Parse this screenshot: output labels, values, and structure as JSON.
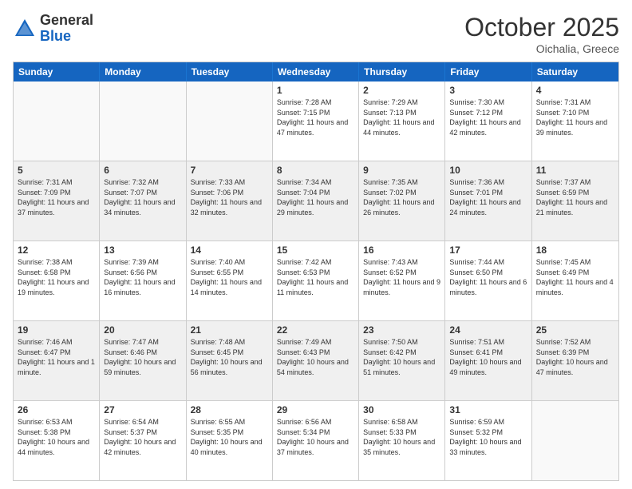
{
  "logo": {
    "general": "General",
    "blue": "Blue"
  },
  "title": "October 2025",
  "subtitle": "Oichalia, Greece",
  "days": [
    "Sunday",
    "Monday",
    "Tuesday",
    "Wednesday",
    "Thursday",
    "Friday",
    "Saturday"
  ],
  "rows": [
    [
      {
        "day": "",
        "text": ""
      },
      {
        "day": "",
        "text": ""
      },
      {
        "day": "",
        "text": ""
      },
      {
        "day": "1",
        "text": "Sunrise: 7:28 AM\nSunset: 7:15 PM\nDaylight: 11 hours and 47 minutes."
      },
      {
        "day": "2",
        "text": "Sunrise: 7:29 AM\nSunset: 7:13 PM\nDaylight: 11 hours and 44 minutes."
      },
      {
        "day": "3",
        "text": "Sunrise: 7:30 AM\nSunset: 7:12 PM\nDaylight: 11 hours and 42 minutes."
      },
      {
        "day": "4",
        "text": "Sunrise: 7:31 AM\nSunset: 7:10 PM\nDaylight: 11 hours and 39 minutes."
      }
    ],
    [
      {
        "day": "5",
        "text": "Sunrise: 7:31 AM\nSunset: 7:09 PM\nDaylight: 11 hours and 37 minutes."
      },
      {
        "day": "6",
        "text": "Sunrise: 7:32 AM\nSunset: 7:07 PM\nDaylight: 11 hours and 34 minutes."
      },
      {
        "day": "7",
        "text": "Sunrise: 7:33 AM\nSunset: 7:06 PM\nDaylight: 11 hours and 32 minutes."
      },
      {
        "day": "8",
        "text": "Sunrise: 7:34 AM\nSunset: 7:04 PM\nDaylight: 11 hours and 29 minutes."
      },
      {
        "day": "9",
        "text": "Sunrise: 7:35 AM\nSunset: 7:02 PM\nDaylight: 11 hours and 26 minutes."
      },
      {
        "day": "10",
        "text": "Sunrise: 7:36 AM\nSunset: 7:01 PM\nDaylight: 11 hours and 24 minutes."
      },
      {
        "day": "11",
        "text": "Sunrise: 7:37 AM\nSunset: 6:59 PM\nDaylight: 11 hours and 21 minutes."
      }
    ],
    [
      {
        "day": "12",
        "text": "Sunrise: 7:38 AM\nSunset: 6:58 PM\nDaylight: 11 hours and 19 minutes."
      },
      {
        "day": "13",
        "text": "Sunrise: 7:39 AM\nSunset: 6:56 PM\nDaylight: 11 hours and 16 minutes."
      },
      {
        "day": "14",
        "text": "Sunrise: 7:40 AM\nSunset: 6:55 PM\nDaylight: 11 hours and 14 minutes."
      },
      {
        "day": "15",
        "text": "Sunrise: 7:42 AM\nSunset: 6:53 PM\nDaylight: 11 hours and 11 minutes."
      },
      {
        "day": "16",
        "text": "Sunrise: 7:43 AM\nSunset: 6:52 PM\nDaylight: 11 hours and 9 minutes."
      },
      {
        "day": "17",
        "text": "Sunrise: 7:44 AM\nSunset: 6:50 PM\nDaylight: 11 hours and 6 minutes."
      },
      {
        "day": "18",
        "text": "Sunrise: 7:45 AM\nSunset: 6:49 PM\nDaylight: 11 hours and 4 minutes."
      }
    ],
    [
      {
        "day": "19",
        "text": "Sunrise: 7:46 AM\nSunset: 6:47 PM\nDaylight: 11 hours and 1 minute."
      },
      {
        "day": "20",
        "text": "Sunrise: 7:47 AM\nSunset: 6:46 PM\nDaylight: 10 hours and 59 minutes."
      },
      {
        "day": "21",
        "text": "Sunrise: 7:48 AM\nSunset: 6:45 PM\nDaylight: 10 hours and 56 minutes."
      },
      {
        "day": "22",
        "text": "Sunrise: 7:49 AM\nSunset: 6:43 PM\nDaylight: 10 hours and 54 minutes."
      },
      {
        "day": "23",
        "text": "Sunrise: 7:50 AM\nSunset: 6:42 PM\nDaylight: 10 hours and 51 minutes."
      },
      {
        "day": "24",
        "text": "Sunrise: 7:51 AM\nSunset: 6:41 PM\nDaylight: 10 hours and 49 minutes."
      },
      {
        "day": "25",
        "text": "Sunrise: 7:52 AM\nSunset: 6:39 PM\nDaylight: 10 hours and 47 minutes."
      }
    ],
    [
      {
        "day": "26",
        "text": "Sunrise: 6:53 AM\nSunset: 5:38 PM\nDaylight: 10 hours and 44 minutes."
      },
      {
        "day": "27",
        "text": "Sunrise: 6:54 AM\nSunset: 5:37 PM\nDaylight: 10 hours and 42 minutes."
      },
      {
        "day": "28",
        "text": "Sunrise: 6:55 AM\nSunset: 5:35 PM\nDaylight: 10 hours and 40 minutes."
      },
      {
        "day": "29",
        "text": "Sunrise: 6:56 AM\nSunset: 5:34 PM\nDaylight: 10 hours and 37 minutes."
      },
      {
        "day": "30",
        "text": "Sunrise: 6:58 AM\nSunset: 5:33 PM\nDaylight: 10 hours and 35 minutes."
      },
      {
        "day": "31",
        "text": "Sunrise: 6:59 AM\nSunset: 5:32 PM\nDaylight: 10 hours and 33 minutes."
      },
      {
        "day": "",
        "text": ""
      }
    ]
  ]
}
